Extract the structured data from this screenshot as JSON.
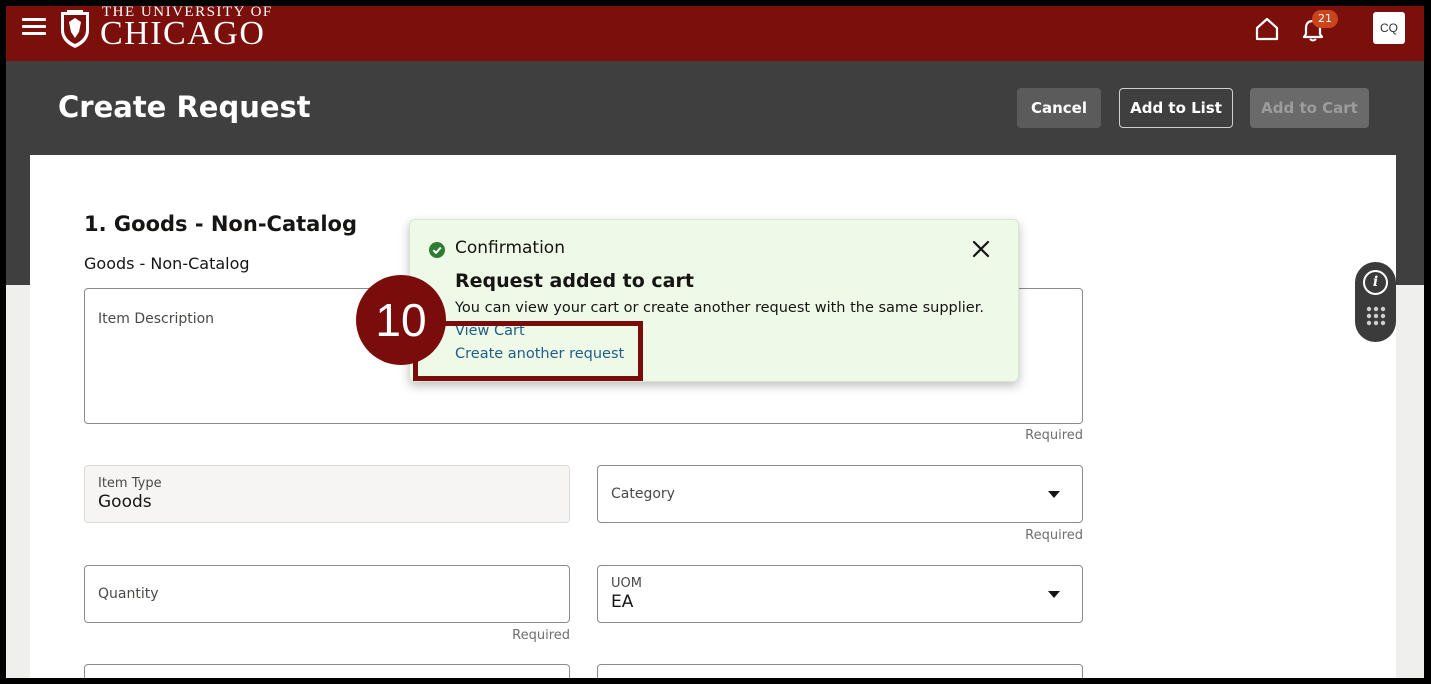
{
  "app": {
    "logo_top": "THE UNIVERSITY OF",
    "logo_main": "CHICAGO",
    "menu_icon": "hamburger-menu-icon",
    "home_icon": "home-icon",
    "bell_icon": "bell-icon",
    "notification_count": "21",
    "user_initials": "CQ",
    "brand_color": "#7b0f0b"
  },
  "page": {
    "title": "Create Request",
    "actions": {
      "cancel": "Cancel",
      "add_to_list": "Add to List",
      "add_to_cart": "Add to Cart"
    }
  },
  "section": {
    "title": "1. Goods - Non-Catalog",
    "subtitle": "Goods - Non-Catalog"
  },
  "form": {
    "item_description": {
      "label": "Item Description",
      "value": "",
      "required": "Required"
    },
    "item_type": {
      "label": "Item Type",
      "value": "Goods"
    },
    "category": {
      "label": "Category",
      "value": "",
      "required": "Required"
    },
    "quantity": {
      "label": "Quantity",
      "value": "",
      "required": "Required"
    },
    "uom": {
      "label": "UOM",
      "value": "EA"
    }
  },
  "toast": {
    "heading": "Confirmation",
    "title": "Request added to cart",
    "message": "You can view your cart or create another request with the same supplier.",
    "links": {
      "view_cart": "View Cart",
      "create_another": "Create another request"
    },
    "status_color": "#2e7d32"
  },
  "annotation": {
    "step_number": "10",
    "color": "#7a0c0b"
  }
}
